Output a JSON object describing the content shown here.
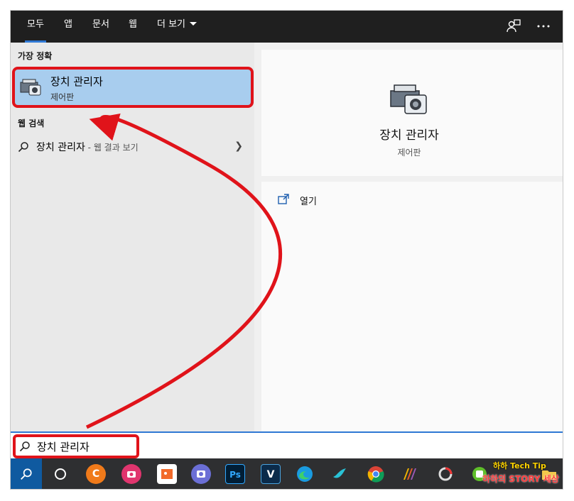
{
  "nav": {
    "tabs": [
      {
        "label": "모두"
      },
      {
        "label": "앱"
      },
      {
        "label": "문서"
      },
      {
        "label": "웹"
      },
      {
        "label": "더 보기"
      }
    ]
  },
  "left": {
    "best_match_header": "가장 정확",
    "best_match": {
      "title": "장치 관리자",
      "subtitle": "제어판"
    },
    "web_header": "웹 검색",
    "web_result": {
      "query": "장치 관리자",
      "suffix": " - 웹 결과 보기"
    }
  },
  "right": {
    "title": "장치 관리자",
    "subtitle": "제어판",
    "open_label": "열기"
  },
  "search": {
    "value": "장치 관리자"
  },
  "taskbar": {
    "icons": [
      "search-icon",
      "cortana-icon",
      "c-app-icon",
      "camera-app-icon",
      "photo-app-icon",
      "screenshot-app-icon",
      "photoshop-icon",
      "v-app-icon",
      "edge-icon",
      "bird-app-icon",
      "chrome-icon",
      "ribbon-app-icon",
      "spinner-app-icon",
      "green-app-icon",
      "folder-icon"
    ],
    "photoshop_label": "Ps",
    "v_label": "V",
    "c_label": "C"
  },
  "watermark": {
    "line1": "하하 Tech Tip",
    "line2": "하하의 STORY 세상"
  },
  "colors": {
    "accent": "#2f78d4",
    "highlight": "#e0131a",
    "selected": "#a8cdee",
    "nav_bg": "#1f1f1f",
    "taskbar_bg": "#2e2f31"
  }
}
